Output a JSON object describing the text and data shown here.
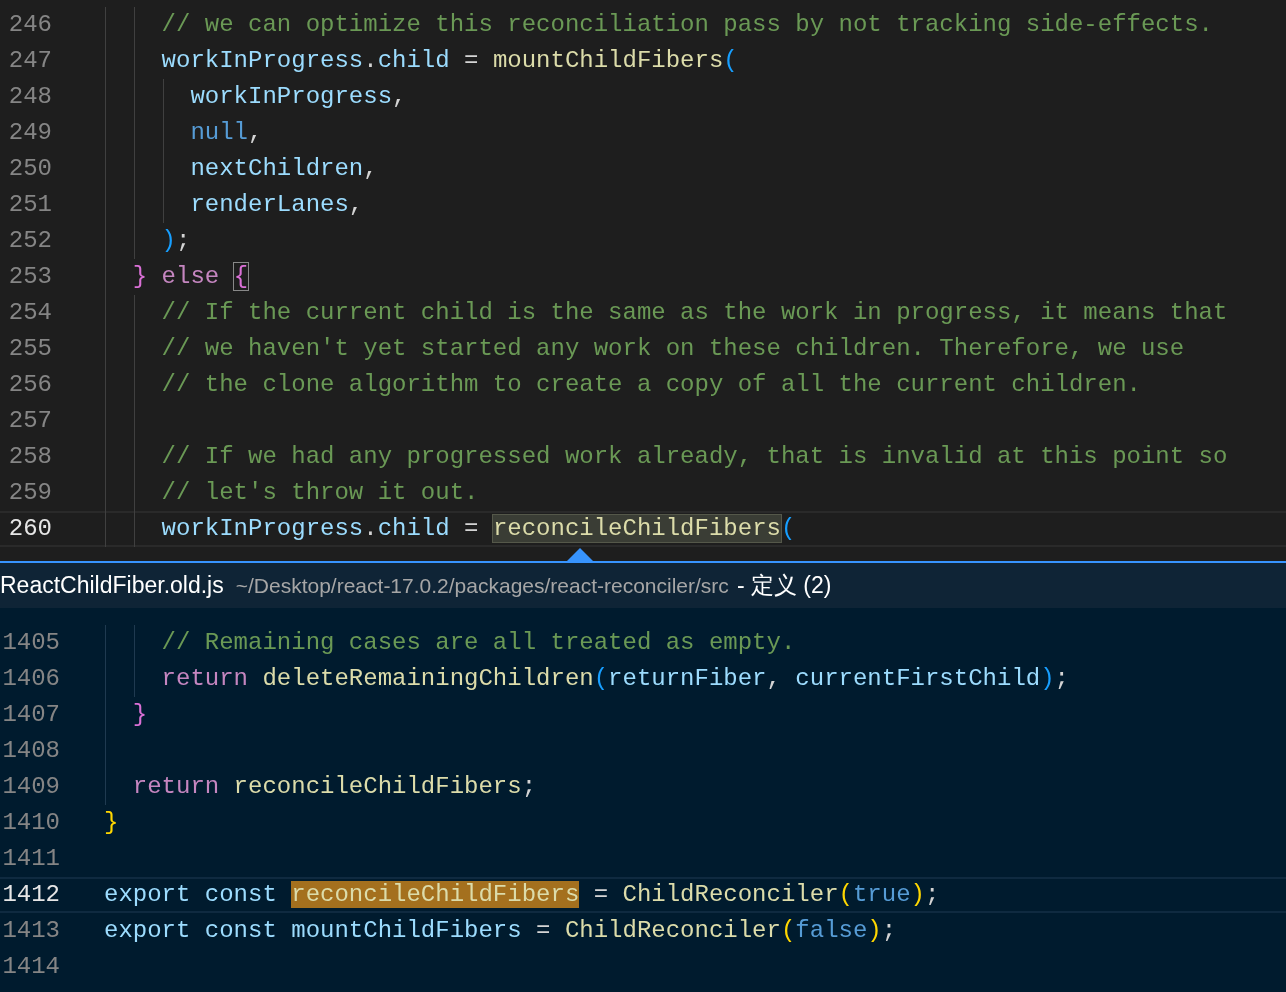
{
  "editor": {
    "lines": [
      {
        "number": "246",
        "current": false,
        "tokens": [
          {
            "text": "    // we can optimize this reconciliation pass by not tracking side-effects.",
            "kind": "comment"
          }
        ]
      },
      {
        "number": "247",
        "current": false,
        "tokens": [
          {
            "text": "    workInProgress",
            "kind": "variable"
          },
          {
            "text": ".",
            "kind": "plain"
          },
          {
            "text": "child",
            "kind": "variable"
          },
          {
            "text": " = ",
            "kind": "plain"
          },
          {
            "text": "mountChildFibers",
            "kind": "function"
          },
          {
            "text": "(",
            "kind": "bracket_blue"
          }
        ]
      },
      {
        "number": "248",
        "current": false,
        "tokens": [
          {
            "text": "      workInProgress",
            "kind": "variable"
          },
          {
            "text": ",",
            "kind": "plain"
          }
        ]
      },
      {
        "number": "249",
        "current": false,
        "tokens": [
          {
            "text": "      null",
            "kind": "constant"
          },
          {
            "text": ",",
            "kind": "plain"
          }
        ]
      },
      {
        "number": "250",
        "current": false,
        "tokens": [
          {
            "text": "      nextChildren",
            "kind": "variable"
          },
          {
            "text": ",",
            "kind": "plain"
          }
        ]
      },
      {
        "number": "251",
        "current": false,
        "tokens": [
          {
            "text": "      renderLanes",
            "kind": "variable"
          },
          {
            "text": ",",
            "kind": "plain"
          }
        ]
      },
      {
        "number": "252",
        "current": false,
        "tokens": [
          {
            "text": "    )",
            "kind": "bracket_blue"
          },
          {
            "text": ";",
            "kind": "plain"
          }
        ]
      },
      {
        "number": "253",
        "current": false,
        "tokens": [
          {
            "text": "  }",
            "kind": "bracket_pink"
          },
          {
            "text": " else ",
            "kind": "keyword"
          },
          {
            "text": "{",
            "kind": "bracket_pink",
            "bracket_match": true
          }
        ]
      },
      {
        "number": "254",
        "current": false,
        "tokens": [
          {
            "text": "    // If the current child is the same as the work in progress, it means that",
            "kind": "comment"
          }
        ]
      },
      {
        "number": "255",
        "current": false,
        "tokens": [
          {
            "text": "    // we haven't yet started any work on these children. Therefore, we use",
            "kind": "comment"
          }
        ]
      },
      {
        "number": "256",
        "current": false,
        "tokens": [
          {
            "text": "    // the clone algorithm to create a copy of all the current children.",
            "kind": "comment"
          }
        ]
      },
      {
        "number": "257",
        "current": false
      },
      {
        "number": "258",
        "current": false,
        "tokens": [
          {
            "text": "    // If we had any progressed work already, that is invalid at this point so",
            "kind": "comment"
          }
        ]
      },
      {
        "number": "259",
        "current": false,
        "tokens": [
          {
            "text": "    // let's throw it out.",
            "kind": "comment"
          }
        ]
      },
      {
        "number": "260",
        "current": true,
        "tokens": [
          {
            "text": "    workInProgress",
            "kind": "variable"
          },
          {
            "text": ".",
            "kind": "plain"
          },
          {
            "text": "child",
            "kind": "variable"
          },
          {
            "text": " = ",
            "kind": "plain"
          },
          {
            "text": "reconcileChildFibers",
            "kind": "function",
            "reference_highlight": true
          },
          {
            "text": "(",
            "kind": "bracket_blue"
          }
        ]
      }
    ]
  },
  "peek": {
    "file": "ReactChildFiber.old.js",
    "path": "~/Desktop/react-17.0.2/packages/react-reconciler/src",
    "suffix": "- 定义 (2)",
    "lines": [
      {
        "number": "1405",
        "current": false,
        "tokens": [
          {
            "text": "    // Remaining cases are all treated as empty.",
            "kind": "comment"
          }
        ]
      },
      {
        "number": "1406",
        "current": false,
        "tokens": [
          {
            "text": "    return",
            "kind": "keyword"
          },
          {
            "text": " deleteRemainingChildren",
            "kind": "function"
          },
          {
            "text": "(",
            "kind": "bracket_blue"
          },
          {
            "text": "returnFiber",
            "kind": "variable"
          },
          {
            "text": ", ",
            "kind": "plain"
          },
          {
            "text": "currentFirstChild",
            "kind": "variable"
          },
          {
            "text": ")",
            "kind": "bracket_blue"
          },
          {
            "text": ";",
            "kind": "plain"
          }
        ]
      },
      {
        "number": "1407",
        "current": false,
        "tokens": [
          {
            "text": "  }",
            "kind": "bracket_pink"
          }
        ]
      },
      {
        "number": "1408",
        "current": false
      },
      {
        "number": "1409",
        "current": false,
        "tokens": [
          {
            "text": "  return",
            "kind": "keyword"
          },
          {
            "text": " reconcileChildFibers",
            "kind": "function"
          },
          {
            "text": ";",
            "kind": "plain"
          }
        ]
      },
      {
        "number": "1410",
        "current": false,
        "tokens": [
          {
            "text": "}",
            "kind": "bracket_yellow"
          }
        ]
      },
      {
        "number": "1411",
        "current": false
      },
      {
        "number": "1412",
        "current": true,
        "tokens": [
          {
            "text": "export const ",
            "kind": "storage"
          },
          {
            "text": "reconcileChildFibers",
            "kind": "function",
            "definition_highlight": true
          },
          {
            "text": " = ",
            "kind": "plain"
          },
          {
            "text": "ChildReconciler",
            "kind": "function"
          },
          {
            "text": "(",
            "kind": "bracket_yellow"
          },
          {
            "text": "true",
            "kind": "constant"
          },
          {
            "text": ")",
            "kind": "bracket_yellow"
          },
          {
            "text": ";",
            "kind": "plain"
          }
        ]
      },
      {
        "number": "1413",
        "current": false,
        "tokens": [
          {
            "text": "export const ",
            "kind": "storage"
          },
          {
            "text": "mountChildFibers",
            "kind": "variable"
          },
          {
            "text": " = ",
            "kind": "plain"
          },
          {
            "text": "ChildReconciler",
            "kind": "function"
          },
          {
            "text": "(",
            "kind": "bracket_yellow"
          },
          {
            "text": "false",
            "kind": "constant"
          },
          {
            "text": ")",
            "kind": "bracket_yellow"
          },
          {
            "text": ";",
            "kind": "plain"
          }
        ]
      },
      {
        "number": "1414",
        "current": false
      }
    ]
  }
}
